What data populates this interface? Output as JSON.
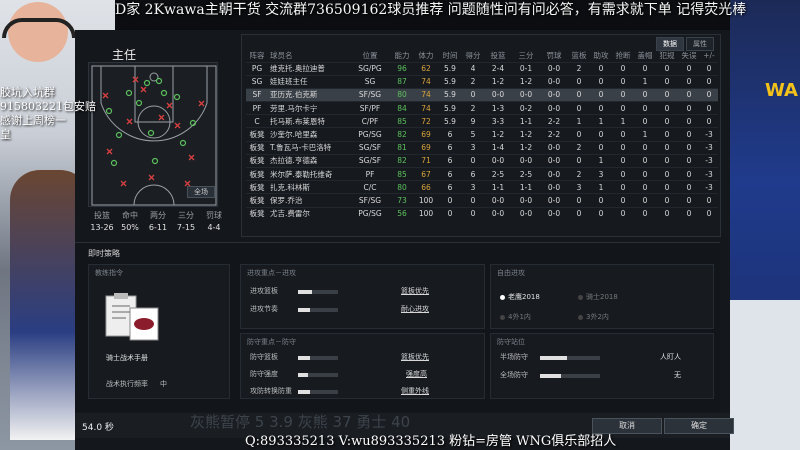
{
  "stream": {
    "top_banner": "D家    2Kwawa主朝干货 交流群736509162球员推荐 问题随性问有问必答，有需求就下单 记得荧光棒",
    "left_lines": [
      "胶坑入坑群",
      "915803221包安赔",
      "感谢上周榜一",
      "皇"
    ],
    "bottom_caption": "Q:893335213 V:wu893335213 粉钻=房管    WNG俱乐部招人",
    "jersey_text": "WA"
  },
  "heading": "主任",
  "shot_chart": {
    "all_button": "全场",
    "summary_headers": [
      "投篮",
      "命中",
      "两分",
      "三分",
      "罚球"
    ],
    "summary_values": [
      "13-26",
      "50%",
      "6-11",
      "7-15",
      "4-4"
    ]
  },
  "stats": {
    "tabs": [
      "数据",
      "属性"
    ],
    "columns": [
      "阵容",
      "球员名",
      "位置",
      "能力",
      "体力",
      "时间",
      "得分",
      "投篮",
      "三分",
      "罚球",
      "篮板",
      "助攻",
      "抢断",
      "盖帽",
      "犯规",
      "失误",
      "+/-"
    ],
    "rows": [
      [
        "PG",
        "维克托.奥拉迪普",
        "SG/PG",
        "96",
        "62",
        "5.9",
        "4",
        "2-4",
        "0-1",
        "0-0",
        "2",
        "0",
        "0",
        "0",
        "0",
        "0",
        "0"
      ],
      [
        "SG",
        "娃娃班主任",
        "SG",
        "87",
        "74",
        "5.9",
        "2",
        "1-2",
        "1-2",
        "0-0",
        "0",
        "0",
        "0",
        "1",
        "0",
        "0",
        "0"
      ],
      [
        "SF",
        "亚历克.伯克斯",
        "SF/SG",
        "80",
        "74",
        "5.9",
        "0",
        "0-0",
        "0-0",
        "0-0",
        "0",
        "0",
        "0",
        "0",
        "0",
        "0",
        "0"
      ],
      [
        "PF",
        "劳里.马尔卡宁",
        "SF/PF",
        "84",
        "74",
        "5.9",
        "2",
        "1-3",
        "0-2",
        "0-0",
        "0",
        "0",
        "0",
        "0",
        "0",
        "0",
        "0"
      ],
      [
        "C",
        "托马斯.布莱恩特",
        "C/PF",
        "85",
        "72",
        "5.9",
        "9",
        "3-3",
        "1-1",
        "2-2",
        "1",
        "1",
        "1",
        "0",
        "0",
        "0",
        "0"
      ],
      [
        "板凳",
        "沙奎尔.哈里森",
        "PG/SG",
        "82",
        "69",
        "6",
        "5",
        "1-2",
        "1-2",
        "2-2",
        "0",
        "0",
        "0",
        "1",
        "0",
        "0",
        "-3"
      ],
      [
        "板凳",
        "T.鲁瓦马-卡巴洛特",
        "SG/SF",
        "81",
        "69",
        "6",
        "3",
        "1-4",
        "1-2",
        "0-0",
        "2",
        "0",
        "0",
        "0",
        "0",
        "0",
        "-3"
      ],
      [
        "板凳",
        "杰拉德.亨德森",
        "SG/SF",
        "82",
        "71",
        "6",
        "0",
        "0-0",
        "0-0",
        "0-0",
        "0",
        "1",
        "0",
        "0",
        "0",
        "0",
        "-3"
      ],
      [
        "板凳",
        "米尔萨.泰勒托维奇",
        "PF",
        "85",
        "67",
        "6",
        "6",
        "2-5",
        "2-5",
        "0-0",
        "2",
        "3",
        "0",
        "0",
        "0",
        "0",
        "-3"
      ],
      [
        "板凳",
        "扎克.科林斯",
        "C/C",
        "80",
        "66",
        "6",
        "3",
        "1-1",
        "1-1",
        "0-0",
        "3",
        "1",
        "0",
        "0",
        "0",
        "0",
        "-3"
      ],
      [
        "板凳",
        "保罗.乔治",
        "SF/SG",
        "73",
        "100",
        "0",
        "0",
        "0-0",
        "0-0",
        "0-0",
        "0",
        "0",
        "0",
        "0",
        "0",
        "0",
        "0"
      ],
      [
        "板凳",
        "尤吉.费雷尔",
        "PG/SG",
        "56",
        "100",
        "0",
        "0",
        "0-0",
        "0-0",
        "0-0",
        "0",
        "0",
        "0",
        "0",
        "0",
        "0",
        "0"
      ]
    ]
  },
  "tactics": {
    "title": "即时策略",
    "coach_box": {
      "header": "教练指令",
      "playbook_label": "骑士战术手册",
      "freq_label": "战术执行频率",
      "freq_value": "中"
    },
    "offense_box": {
      "header": "进攻重点－进攻",
      "items": [
        {
          "label": "进攻篮板",
          "value": 0.35,
          "link": "篮板优先"
        },
        {
          "label": "进攻节奏",
          "value": 0.3,
          "link": "耐心进攻"
        }
      ]
    },
    "defense_box": {
      "header": "防守重点－防守",
      "items": [
        {
          "label": "防守篮板",
          "value": 0.3,
          "link": "篮板优先"
        },
        {
          "label": "防守强度",
          "value": 0.25,
          "link": "强度高"
        },
        {
          "label": "攻防转换防重",
          "value": 0.3,
          "link": "侧重外线"
        }
      ]
    },
    "auto_box": {
      "header": "自由进攻",
      "options": [
        {
          "label": "老鹰2018",
          "on": true
        },
        {
          "label": "骑士2018",
          "on": false
        },
        {
          "label": "4外1内",
          "on": false
        },
        {
          "label": "3外2内",
          "on": false
        }
      ]
    },
    "def_sys_box": {
      "header": "防守站位",
      "items": [
        {
          "label": "半场防守",
          "value": 0.45,
          "right": "人盯人"
        },
        {
          "label": "全场防守",
          "value": 0.35,
          "right": "无"
        }
      ]
    }
  },
  "bottom": {
    "timer": "54.0 秒",
    "score_ghost": "灰熊暂停       5 3.9 灰熊  37  勇士   40",
    "cancel": "取消",
    "confirm": "确定",
    "colors": {
      "green": "#5cc05c",
      "orange": "#d8a33a"
    }
  }
}
